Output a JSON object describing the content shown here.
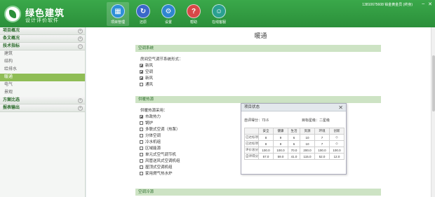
{
  "brand": {
    "title": "绿色建筑",
    "subtitle": "设计评价软件"
  },
  "nav": [
    {
      "label": "项目管理",
      "glyph": "▦",
      "color": "#2e8fd8"
    },
    {
      "label": "还原",
      "glyph": "↻",
      "color": "#3a68c8"
    },
    {
      "label": "设置",
      "glyph": "⚙",
      "color": "#2f86d0"
    },
    {
      "label": "帮助",
      "glyph": "?",
      "color": "#d84848"
    },
    {
      "label": "在线客服",
      "glyph": "☺",
      "color": "#2aa090"
    }
  ],
  "user_info": "13810675608 铂金黄金员 (终身)",
  "window_controls": {
    "minimize": "–",
    "close": "✕"
  },
  "sidebar": {
    "sections": [
      {
        "label": "项目概况",
        "toggle": "+"
      },
      {
        "label": "条文概况",
        "toggle": "+"
      },
      {
        "label": "技术指标",
        "toggle": "–"
      }
    ],
    "items": [
      "建筑",
      "结构",
      "给排水",
      "暖通",
      "电气",
      "景观"
    ],
    "sections_after": [
      {
        "label": "方案比选",
        "toggle": "+"
      },
      {
        "label": "报表输出",
        "toggle": "+"
      }
    ]
  },
  "page_title": "暖通",
  "sections": {
    "ac_system": {
      "bar": "空调系统",
      "title": "房间空气调节系统形式：",
      "options": [
        {
          "label": "新风",
          "checked": true
        },
        {
          "label": "空调",
          "checked": true
        },
        {
          "label": "新风",
          "checked": true
        },
        {
          "label": "通风",
          "checked": false
        }
      ]
    },
    "heat_source": {
      "bar": "供暖热源",
      "title": "供暖热源采用：",
      "options": [
        {
          "label": "市政热力",
          "checked": true
        },
        {
          "label": "锅炉",
          "checked": false
        },
        {
          "label": "多联式空调（热泵）",
          "checked": false
        },
        {
          "label": "分体空调",
          "checked": false
        },
        {
          "label": "冷水机组",
          "checked": false
        },
        {
          "label": "区域能源",
          "checked": false
        },
        {
          "label": "单元式空气调节机",
          "checked": false
        },
        {
          "label": "风管送风式空调机组",
          "checked": false
        },
        {
          "label": "屋顶式空调机组",
          "checked": false
        },
        {
          "label": "家用燃气热水炉",
          "checked": false
        }
      ]
    },
    "ac_cooling": {
      "bar": "空调冷源"
    }
  },
  "popup": {
    "title": "项目状态",
    "close": "✕",
    "self_score": "自评得分：73.6",
    "target_star": "目标星级：二星级",
    "columns": [
      "",
      "安全",
      "健康",
      "生活",
      "资源",
      "环境",
      "创新"
    ],
    "rows": [
      [
        "已达标项",
        "8",
        "9",
        "6",
        "10",
        "7",
        "◇"
      ],
      [
        "已达标项",
        "8",
        "9",
        "6",
        "10",
        "7",
        "◇"
      ],
      [
        "评价总分",
        "100.0",
        "100.0",
        "70.0",
        "200.0",
        "100.0",
        "100.0"
      ],
      [
        "自评得分",
        "57.0",
        "59.0",
        "41.0",
        "115.0",
        "52.0",
        "12.0"
      ]
    ]
  }
}
